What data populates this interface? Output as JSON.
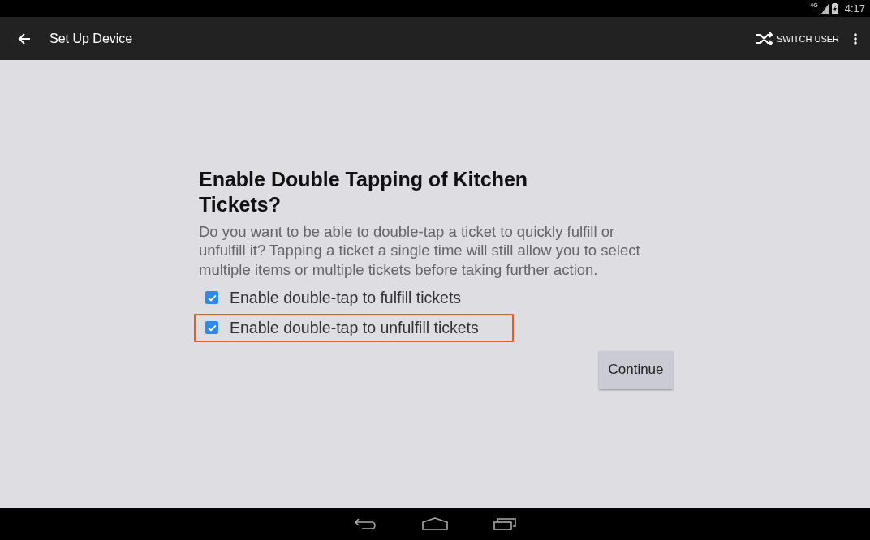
{
  "status_bar": {
    "network": "4G",
    "time": "4:17"
  },
  "app_bar": {
    "title": "Set Up Device",
    "action": "SWITCH USER"
  },
  "dialog": {
    "title": "Enable Double Tapping of Kitchen Tickets?",
    "description": "Do you want to be able to double-tap a ticket to quickly fulfill or unfulfill it? Tapping a ticket a single time will still allow you to select multiple items or multiple tickets before taking further action.",
    "options": [
      {
        "label": "Enable double-tap to fulfill tickets",
        "checked": true,
        "highlighted": false
      },
      {
        "label": "Enable double-tap to unfulfill tickets",
        "checked": true,
        "highlighted": true
      }
    ],
    "button": "Continue"
  }
}
